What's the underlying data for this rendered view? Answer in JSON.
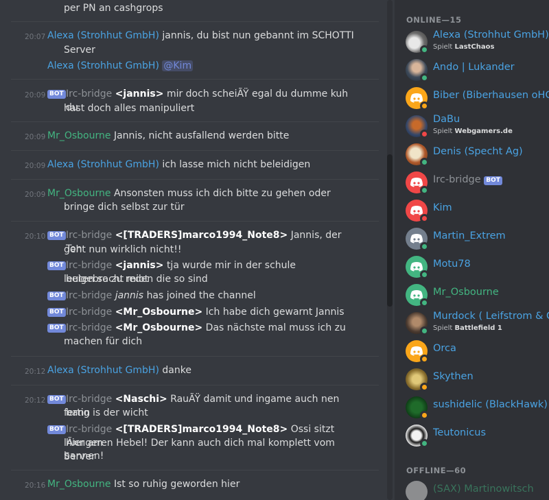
{
  "colors": {
    "background": "#36393f",
    "sidebar": "#2f3136",
    "alexa": "#4aa3e3",
    "mr_osbourne": "#43b581",
    "bot_badge": "#7289da",
    "online": "#43b581",
    "idle": "#faa61a",
    "dnd": "#f04747"
  },
  "chat": {
    "top_fragment": "per PN an cashgrops",
    "bot_label": "BOT",
    "messages": [
      {
        "time": "20:07",
        "author": "Alexa (Strohhut GmbH)",
        "line1": "jannis, du bist nun gebannt im SCHOTTI",
        "line2": "Server"
      },
      {
        "author": "Alexa (Strohhut GmbH)",
        "mention": "@Kim"
      },
      {
        "time": "20:09",
        "author": "Irc-bridge",
        "nick": "<jannis>",
        "line1": "mir doch scheiÃŸ egal du dumme kuh  du",
        "line2": "hast doch alles manipuliert"
      },
      {
        "time": "20:09",
        "author": "Mr_Osbourne",
        "line1": "Jannis, nicht ausfallend werden bitte"
      },
      {
        "time": "20:09",
        "author": "Alexa (Strohhut GmbH)",
        "line1": "ich lasse mich nicht beleidigen"
      },
      {
        "time": "20:09",
        "author": "Mr_Osbourne",
        "line1": "Ansonsten muss ich dich bitte zu gehen oder",
        "line2": "bringe dich selbst zur tür"
      },
      {
        "time": "20:10",
        "author": "Irc-bridge",
        "nick": "<[TRADERS]marco1994_Note8>",
        "line1": "Jannis, der Ton",
        "line2": "geht nun wirklich nicht!!"
      },
      {
        "author": "Irc-bridge",
        "nick": "<jannis>",
        "line1": "tja wurde mir in der schule beigebracht miot",
        "line2": "leuten so zu reden die so sind"
      },
      {
        "author": "Irc-bridge",
        "italic": "jannis",
        "line1": "has joined the channel"
      },
      {
        "author": "Irc-bridge",
        "nick": "<Mr_Osbourne>",
        "line1": "Ich habe dich gewarnt Jannis"
      },
      {
        "author": "Irc-bridge",
        "nick": "<Mr_Osbourne>",
        "line1": "Das nächste mal muss ich zu",
        "line2": "machen für dich"
      },
      {
        "time": "20:12",
        "author": "Alexa (Strohhut GmbH)",
        "line1": "danke"
      },
      {
        "time": "20:12",
        "author": "Irc-bridge",
        "nick": "<Naschi>",
        "line1": "RauÃŸ damit und ingame auch nen bann",
        "line2": "fertig is der wicht"
      },
      {
        "author": "Irc-bridge",
        "nick": "<[TRADERS]marco1994_Note8>",
        "line1": "Ossi sitzt hier am",
        "line2": "lÃ¤ngeren Hebel! Der kann auch dich mal komplett vom Server",
        "line3": "bannen!"
      },
      {
        "time": "20:16",
        "author": "Mr_Osbourne",
        "line1": "Ist so ruhig geworden hier"
      }
    ]
  },
  "members": {
    "online_header": "ONLINE—15",
    "offline_header": "OFFLINE—60",
    "online": [
      {
        "name": "Alexa (Strohhut GmbH)",
        "activity_prefix": "Spielt",
        "activity": "LastChaos",
        "status": "online"
      },
      {
        "name": "Ando | Lukander",
        "status": "online"
      },
      {
        "name": "Biber (Biberhausen oHG)",
        "status": "idle"
      },
      {
        "name": "DaBu",
        "activity_prefix": "Spielt",
        "activity": "Webgamers.de",
        "status": "dnd"
      },
      {
        "name": "Denis (Specht Ag)",
        "status": "online"
      },
      {
        "name": "Irc-bridge",
        "badge": "BOT",
        "status": "online"
      },
      {
        "name": "Kim",
        "status": "dnd"
      },
      {
        "name": "Martin_Extrem",
        "status": "online"
      },
      {
        "name": "Motu78",
        "status": "online"
      },
      {
        "name": "Mr_Osbourne",
        "status": "online"
      },
      {
        "name": "Murdock ( Leifstrom & Co)",
        "activity_prefix": "Spielt",
        "activity": "Battlefield 1",
        "status": "online"
      },
      {
        "name": "Orca",
        "status": "idle"
      },
      {
        "name": "Skythen",
        "status": "idle"
      },
      {
        "name": "sushidelic (BlackHawk)",
        "status": "idle"
      },
      {
        "name": "Teutonicus",
        "status": "online"
      }
    ],
    "offline": [
      {
        "name": "(SAX) Martinowitsch"
      }
    ]
  }
}
